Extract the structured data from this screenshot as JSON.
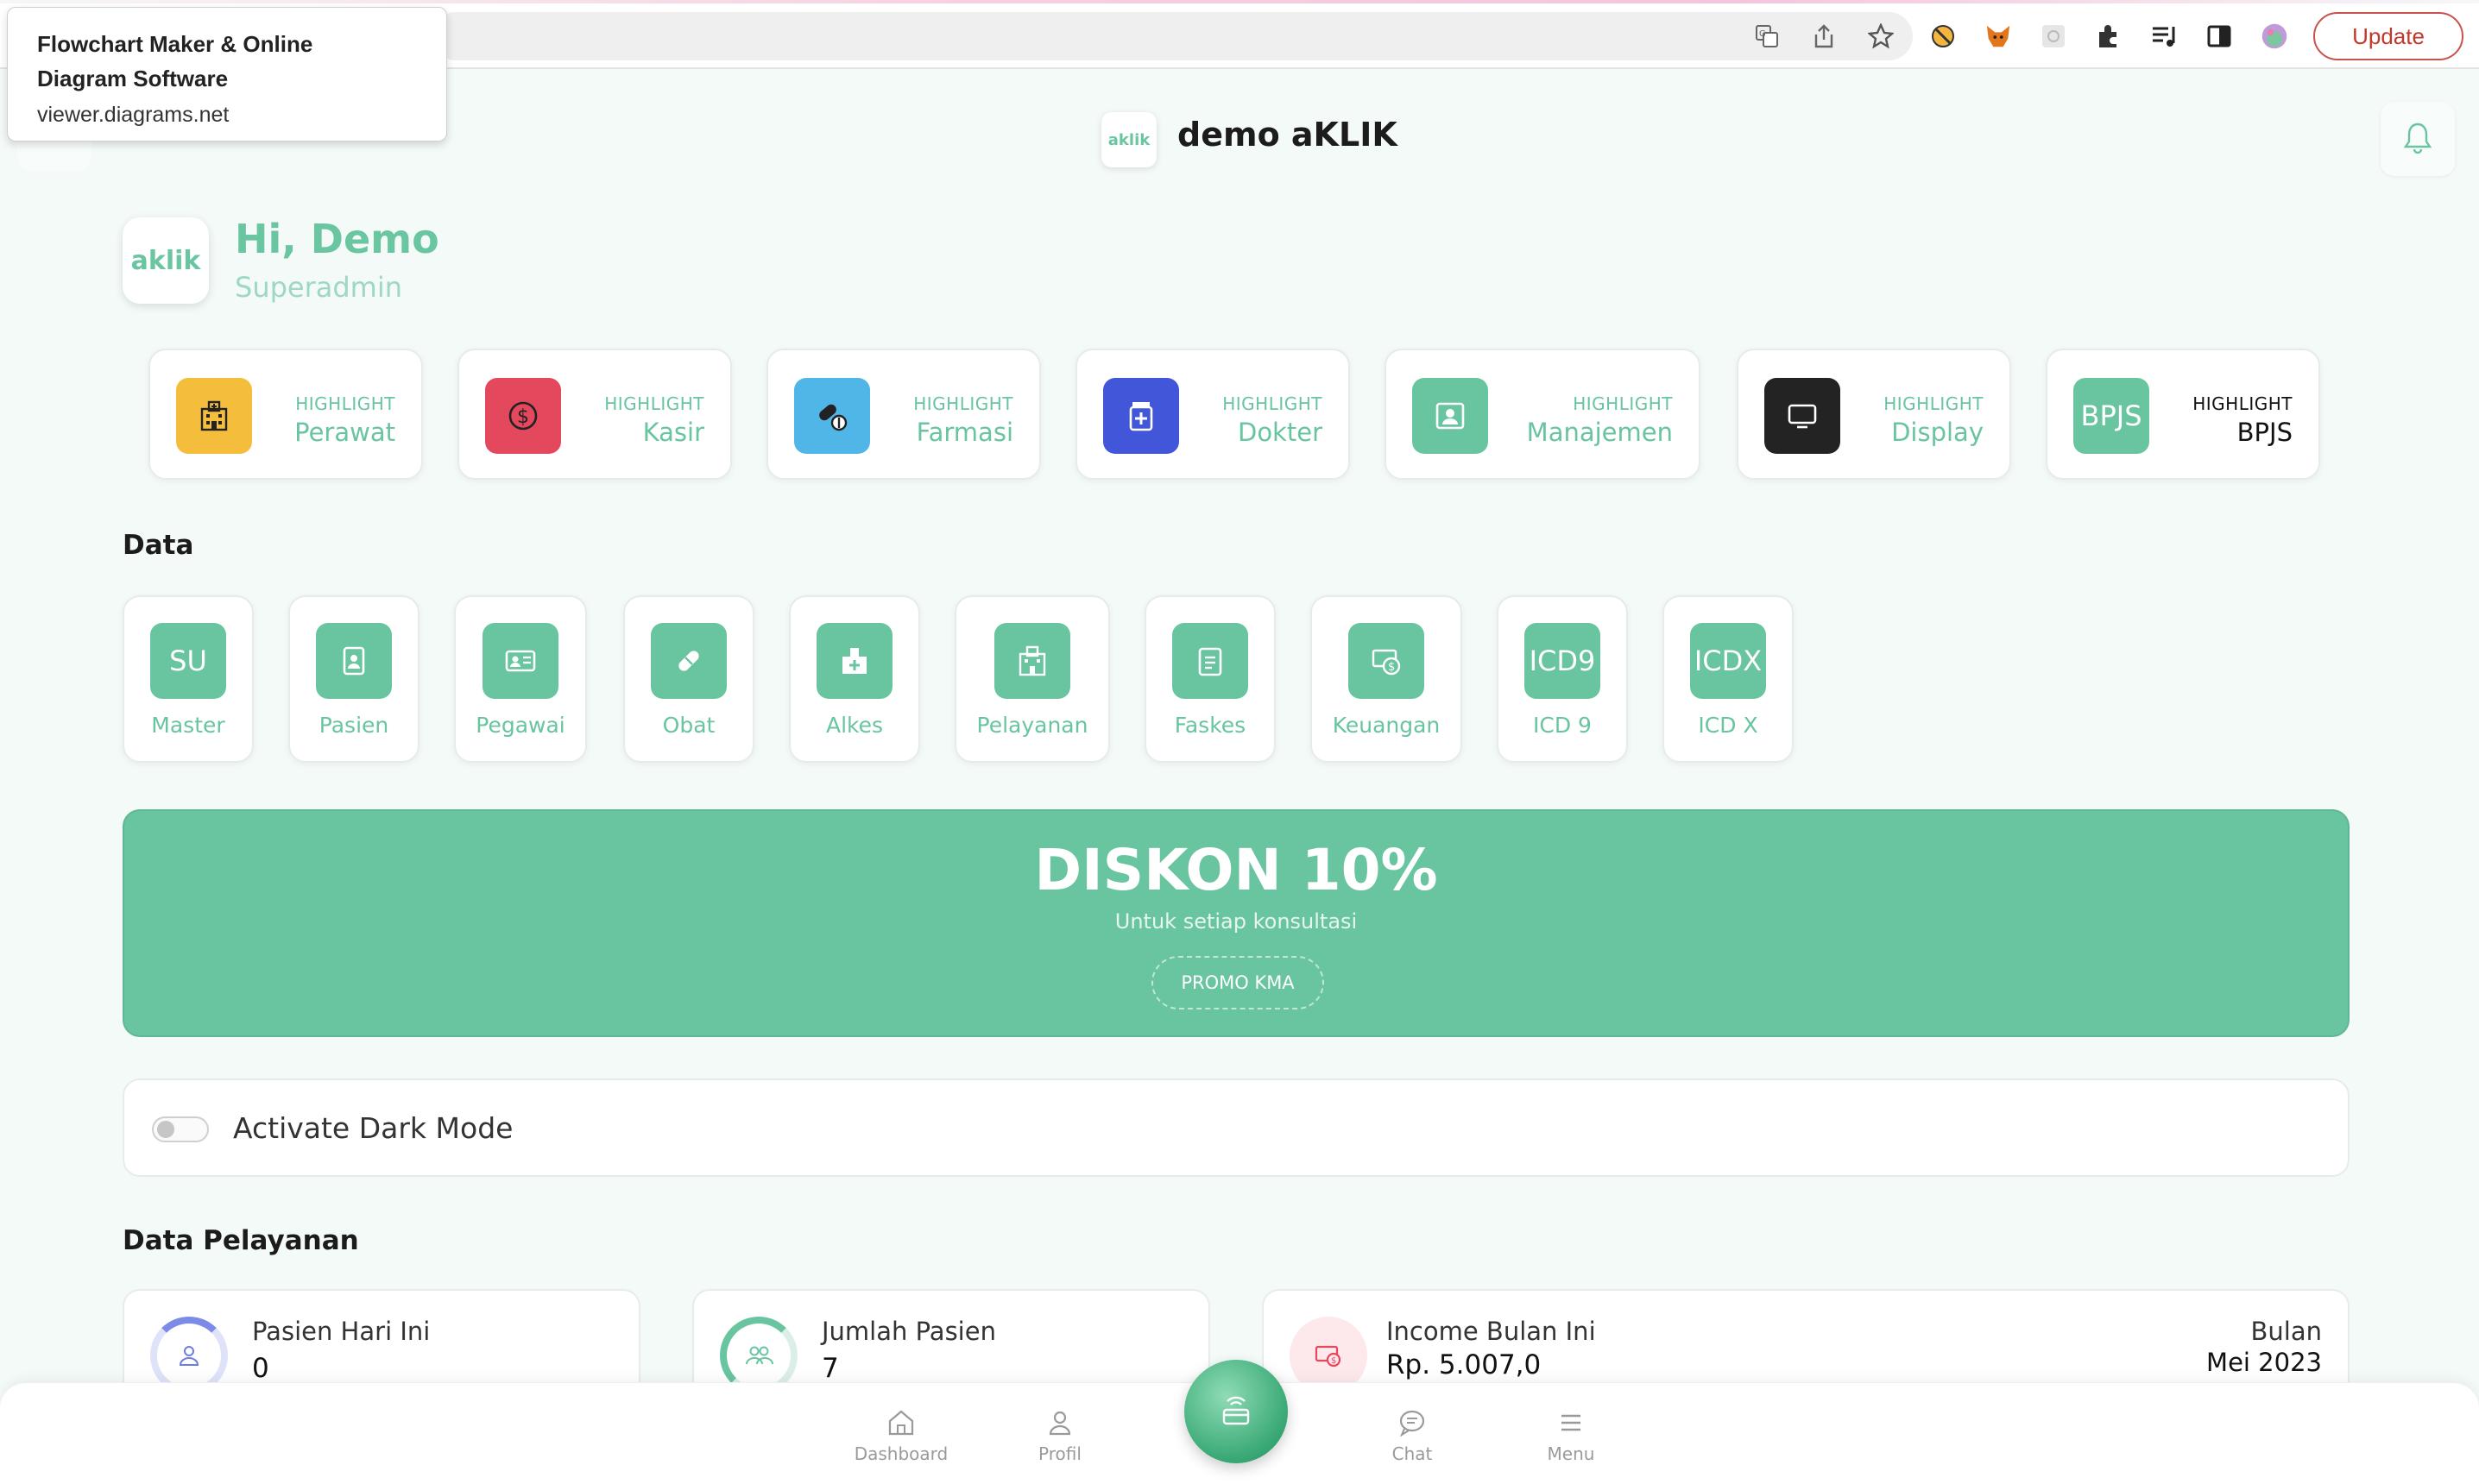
{
  "browser": {
    "tooltip_title": "Flowchart Maker & Online Diagram Software",
    "tooltip_url": "viewer.diagrams.net",
    "update_label": "Update",
    "icons": [
      "translate-icon",
      "share-icon",
      "star-icon",
      "extension-icons",
      "puzzle-icon",
      "media-icon",
      "sidepanel-icon",
      "profile-avatar"
    ]
  },
  "header": {
    "logo_text": "aklik",
    "title": "demo aKLIK"
  },
  "user": {
    "avatar_text": "aklik",
    "greeting": "Hi, Demo",
    "role": "Superadmin"
  },
  "highlights": [
    {
      "small": "HIGHLIGHT",
      "name": "Perawat",
      "color": "#f4be3c",
      "icon": "hospital-icon"
    },
    {
      "small": "HIGHLIGHT",
      "name": "Kasir",
      "color": "#e4485d",
      "icon": "dollar-icon"
    },
    {
      "small": "HIGHLIGHT",
      "name": "Farmasi",
      "color": "#4fb6e7",
      "icon": "pills-icon"
    },
    {
      "small": "HIGHLIGHT",
      "name": "Dokter",
      "color": "#4156d9",
      "icon": "medicine-icon"
    },
    {
      "small": "HIGHLIGHT",
      "name": "Manajemen",
      "color": "#69c4a0",
      "icon": "id-photo-icon"
    },
    {
      "small": "HIGHLIGHT",
      "name": "Display",
      "color": "#232323",
      "icon": "monitor-icon"
    },
    {
      "small": "HIGHLIGHT",
      "name": "BPJS",
      "color": "#69c4a0",
      "icon_text": "BPJS"
    }
  ],
  "data_section": {
    "title": "Data",
    "tiles": [
      {
        "name": "Master",
        "icon_text": "SU"
      },
      {
        "name": "Pasien",
        "icon": "patient-icon"
      },
      {
        "name": "Pegawai",
        "icon": "id-card-icon"
      },
      {
        "name": "Obat",
        "icon": "capsule-icon"
      },
      {
        "name": "Alkes",
        "icon": "medkit-icon"
      },
      {
        "name": "Pelayanan",
        "icon": "hospital-icon"
      },
      {
        "name": "Faskes",
        "icon": "clipboard-icon"
      },
      {
        "name": "Keuangan",
        "icon": "money-icon"
      },
      {
        "name": "ICD 9",
        "icon_text": "ICD9"
      },
      {
        "name": "ICD X",
        "icon_text": "ICDX"
      }
    ]
  },
  "promo": {
    "headline": "DISKON 10%",
    "subtitle": "Untuk setiap konsultasi",
    "button": "PROMO KMA"
  },
  "dark_mode": {
    "label": "Activate Dark Mode",
    "enabled": false
  },
  "pelayanan": {
    "title": "Data Pelayanan",
    "cards": [
      {
        "title": "Pasien Hari Ini",
        "value": "0",
        "icon": "person-icon"
      },
      {
        "title": "Jumlah Pasien",
        "value": "7",
        "icon": "group-icon"
      },
      {
        "title": "Income Bulan Ini",
        "value": "Rp. 5.007,0",
        "icon": "income-icon",
        "side_label": "Bulan",
        "side_value": "Mei 2023"
      }
    ]
  },
  "bottom_nav": {
    "items": [
      "Dashboard",
      "Profil",
      "Chat",
      "Menu"
    ],
    "fab_icon": "contactless-card-icon"
  }
}
